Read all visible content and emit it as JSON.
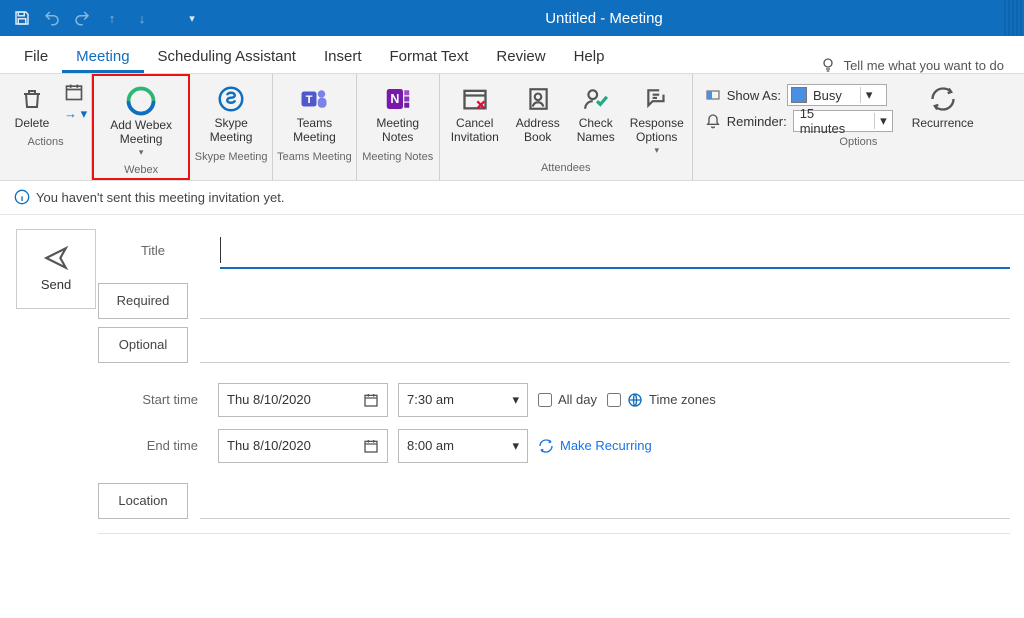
{
  "window": {
    "title": "Untitled  -  Meeting"
  },
  "tabs": {
    "file": "File",
    "meeting": "Meeting",
    "scheduling": "Scheduling Assistant",
    "insert": "Insert",
    "format": "Format Text",
    "review": "Review",
    "help": "Help",
    "search_hint": "Tell me what you want to do"
  },
  "ribbon": {
    "actions": {
      "label": "Actions",
      "delete": "Delete"
    },
    "webex": {
      "label": "Webex",
      "add": "Add Webex\nMeeting"
    },
    "skype": {
      "label": "Skype Meeting",
      "btn": "Skype\nMeeting"
    },
    "teams": {
      "label": "Teams Meeting",
      "btn": "Teams\nMeeting"
    },
    "notes": {
      "label": "Meeting Notes",
      "btn": "Meeting\nNotes"
    },
    "attendees": {
      "label": "Attendees",
      "cancel": "Cancel\nInvitation",
      "address": "Address\nBook",
      "check": "Check\nNames",
      "response": "Response\nOptions"
    },
    "options": {
      "label": "Options",
      "show_as": "Show As:",
      "show_as_value": "Busy",
      "reminder": "Reminder:",
      "reminder_value": "15 minutes",
      "recurrence": "Recurrence"
    }
  },
  "info_bar": "You haven't sent this meeting invitation yet.",
  "compose": {
    "send": "Send",
    "title_label": "Title",
    "required": "Required",
    "optional": "Optional",
    "start_label": "Start time",
    "end_label": "End time",
    "start_date": "Thu 8/10/2020",
    "start_time": "7:30 am",
    "end_date": "Thu 8/10/2020",
    "end_time": "8:00 am",
    "all_day": "All day",
    "time_zones": "Time zones",
    "make_recurring": "Make Recurring",
    "location": "Location"
  }
}
